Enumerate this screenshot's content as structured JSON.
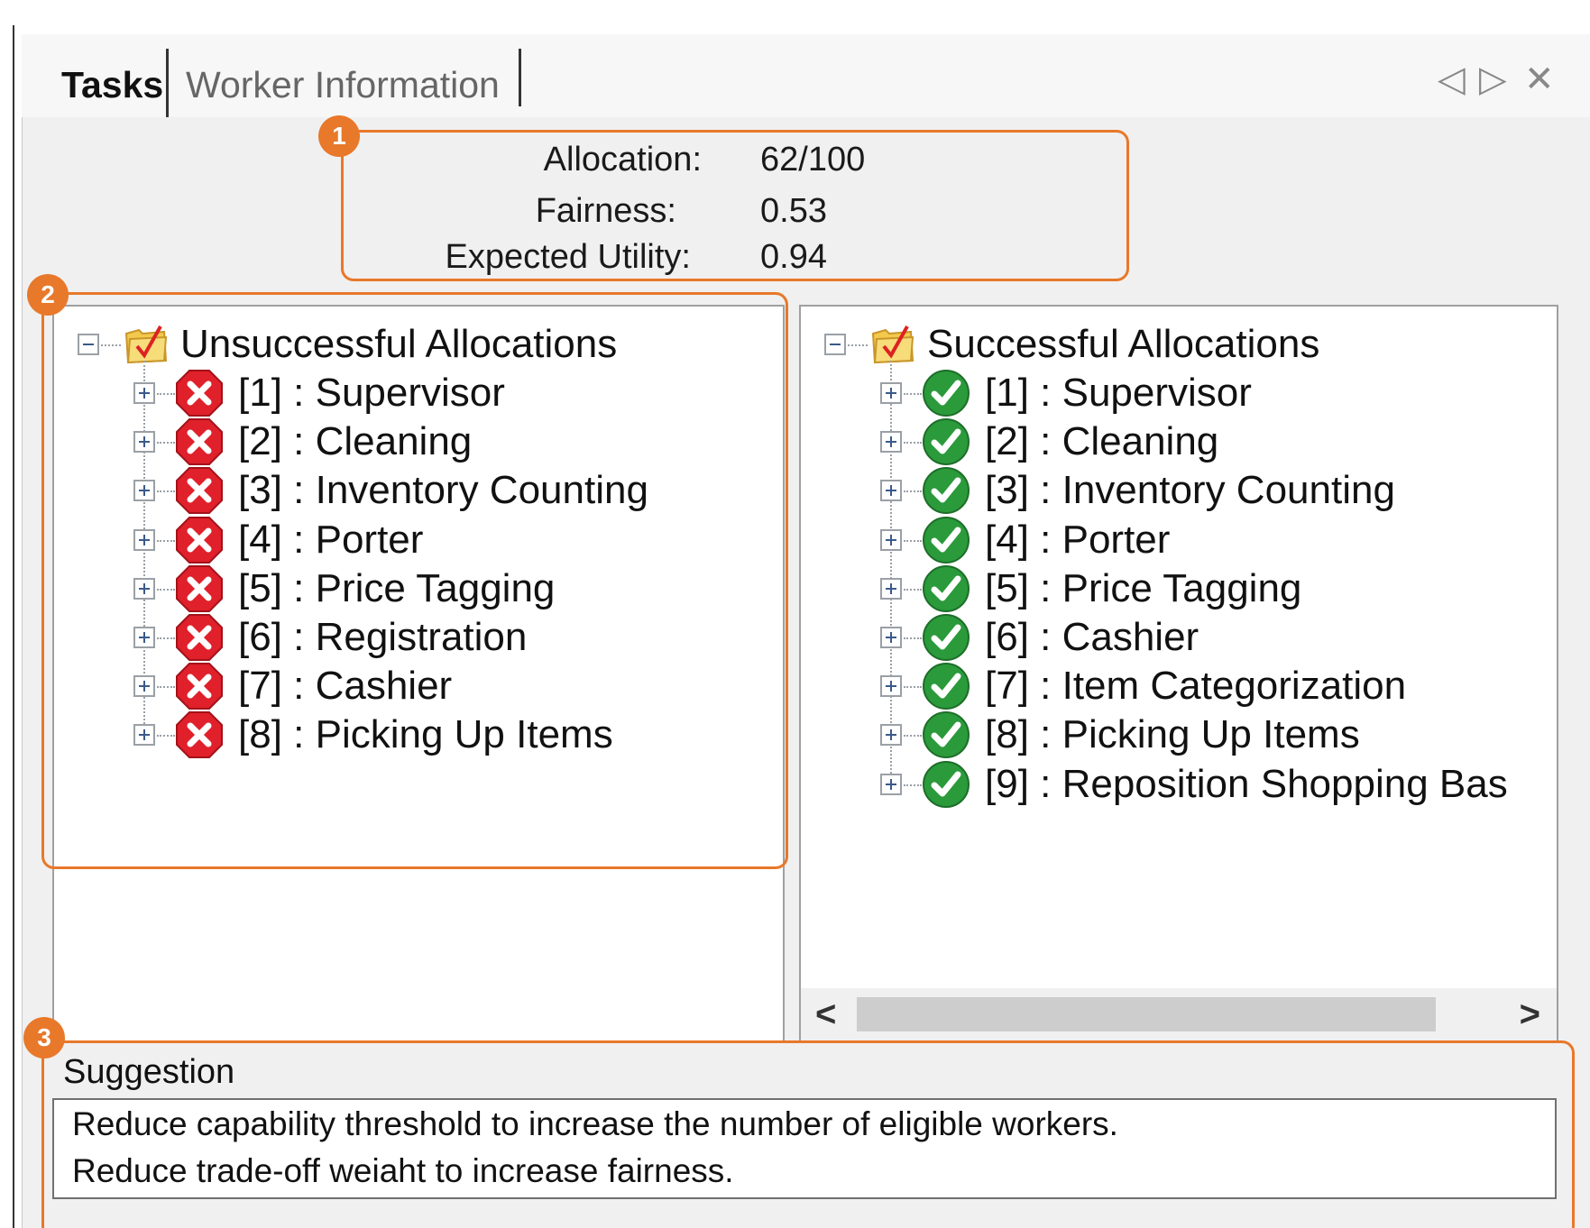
{
  "tabs": [
    {
      "label": "Tasks",
      "active": true
    },
    {
      "label": "Worker Information",
      "active": false
    }
  ],
  "window_controls": {
    "prev_glyph": "◁",
    "next_glyph": "▷",
    "close_glyph": "✕"
  },
  "badges": [
    "1",
    "2",
    "3"
  ],
  "summary": {
    "allocation_label": "Allocation:",
    "allocation_value": "62/100",
    "fairness_label": "Fairness:",
    "fairness_value": "0.53",
    "utility_label": "Expected Utility:",
    "utility_value": "0.94"
  },
  "unsuccessful": {
    "title": "Unsuccessful Allocations",
    "icon": "checklist-folder-icon",
    "status_icon": "red-x-icon",
    "items": [
      "[1] : Supervisor",
      "[2] : Cleaning",
      "[3] : Inventory Counting",
      "[4] : Porter",
      "[5] : Price Tagging",
      "[6] : Registration",
      "[7] : Cashier",
      "[8] : Picking Up Items"
    ]
  },
  "successful": {
    "title": "Successful Allocations",
    "icon": "checklist-folder-icon",
    "status_icon": "green-check-icon",
    "items": [
      "[1] : Supervisor",
      "[2] : Cleaning",
      "[3] : Inventory Counting",
      "[4] : Porter",
      "[5] : Price Tagging",
      "[6] : Cashier",
      "[7] : Item Categorization",
      "[8] : Picking Up Items",
      "[9] : Reposition Shopping Bas"
    ]
  },
  "scrollbar": {
    "left_glyph": "<",
    "right_glyph": ">"
  },
  "suggestion": {
    "title": "Suggestion",
    "lines": [
      "Reduce capability threshold to increase the number of eligible workers.",
      "Reduce trade-off weiaht to increase fairness."
    ]
  },
  "colors": {
    "accent": "#e8782a",
    "error": "#e0202a",
    "success": "#2a9a3a"
  }
}
